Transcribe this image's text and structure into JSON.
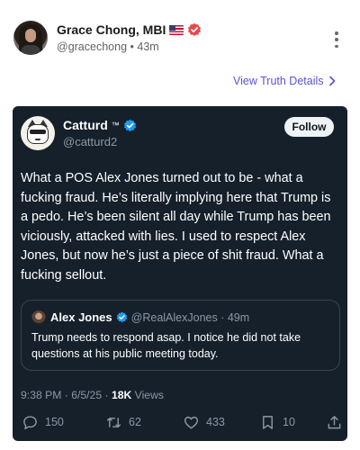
{
  "post": {
    "author_name": "Grace Chong, MBI",
    "author_handle": "@gracechong",
    "time_ago": "43m",
    "handle_separator": "•",
    "view_details_label": "View Truth Details"
  },
  "embedded_tweet": {
    "author_name": "Catturd",
    "author_name_suffix": "™",
    "author_handle": "@catturd2",
    "follow_label": "Follow",
    "text": "What a POS Alex Jones turned out to be - what a fucking fraud.  He’s literally implying here that Trump is a pedo. He’s been silent all day while Trump has been viciously, attacked with lies. I used to respect Alex Jones, but now he’s just a piece of shit fraud. What a fucking sellout.",
    "quoted": {
      "author_name": "Alex Jones",
      "meta": "@RealAlexJones · 49m",
      "text": "Trump needs to respond asap. I notice he did not take questions at his public meeting today."
    },
    "timestamp": "9:38 PM · 6/5/25 · ",
    "views_count": "18K",
    "views_label": " Views",
    "actions": {
      "replies": "150",
      "reposts": "62",
      "likes": "433",
      "bookmarks": "10"
    }
  },
  "colors": {
    "accent_link": "#5b52d6",
    "verified_badge": "#e5484d",
    "card_background": "#15202b",
    "twitter_verified": "#1d9bf0"
  },
  "icons": [
    "us-flag-icon",
    "verified-badge-icon",
    "more-vertical-icon",
    "chevron-right-icon",
    "reply-icon",
    "repost-icon",
    "like-icon",
    "bookmark-icon",
    "share-icon"
  ]
}
